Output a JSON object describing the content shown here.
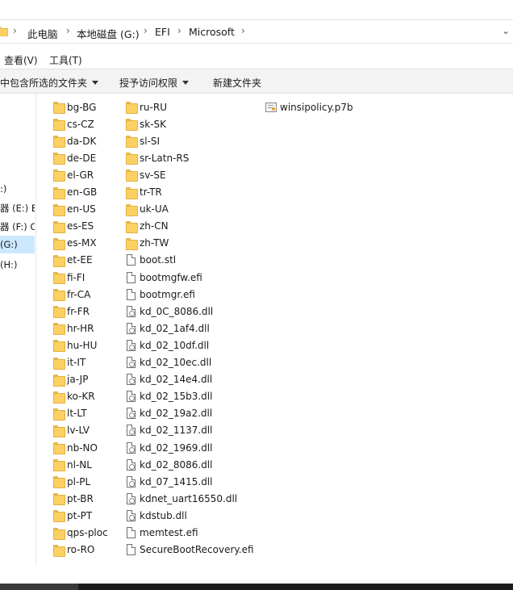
{
  "address": {
    "crumbs": [
      "此电脑",
      "本地磁盘 (G:)",
      "EFI",
      "Microsoft"
    ],
    "separator": "›",
    "dropdown": "⌄"
  },
  "menu": {
    "view": "查看(V)",
    "tools": "工具(T)"
  },
  "commands": {
    "include_in_library": "中包含所选的文件夹",
    "grant_access": "授予访问权限",
    "new_folder": "新建文件夹"
  },
  "nav": {
    "items": [
      ":)",
      "器 (E:) E",
      "器 (F:) C",
      "(G:)",
      "(H:)"
    ]
  },
  "files": {
    "col1": [
      "bg-BG",
      "cs-CZ",
      "da-DK",
      "de-DE",
      "el-GR",
      "en-GB",
      "en-US",
      "es-ES",
      "es-MX",
      "et-EE",
      "fi-FI",
      "fr-CA",
      "fr-FR",
      "hr-HR",
      "hu-HU",
      "it-IT",
      "ja-JP",
      "ko-KR",
      "lt-LT",
      "lv-LV",
      "nb-NO",
      "nl-NL",
      "pl-PL",
      "pt-BR",
      "pt-PT",
      "qps-ploc",
      "ro-RO"
    ],
    "col2_folders": [
      "ru-RU",
      "sk-SK",
      "sl-SI",
      "sr-Latn-RS",
      "sv-SE",
      "tr-TR",
      "uk-UA",
      "zh-CN",
      "zh-TW"
    ],
    "col2_files": [
      "boot.stl",
      "bootmgfw.efi",
      "bootmgr.efi"
    ],
    "col2_dlls": [
      "kd_0C_8086.dll",
      "kd_02_1af4.dll",
      "kd_02_10df.dll",
      "kd_02_10ec.dll",
      "kd_02_14e4.dll",
      "kd_02_15b3.dll",
      "kd_02_19a2.dll",
      "kd_02_1137.dll",
      "kd_02_1969.dll",
      "kd_02_8086.dll",
      "kd_07_1415.dll",
      "kdnet_uart16550.dll",
      "kdstub.dll"
    ],
    "col2_tail": [
      "memtest.efi",
      "SecureBootRecovery.efi"
    ],
    "col3": [
      "winsipolicy.p7b"
    ]
  }
}
